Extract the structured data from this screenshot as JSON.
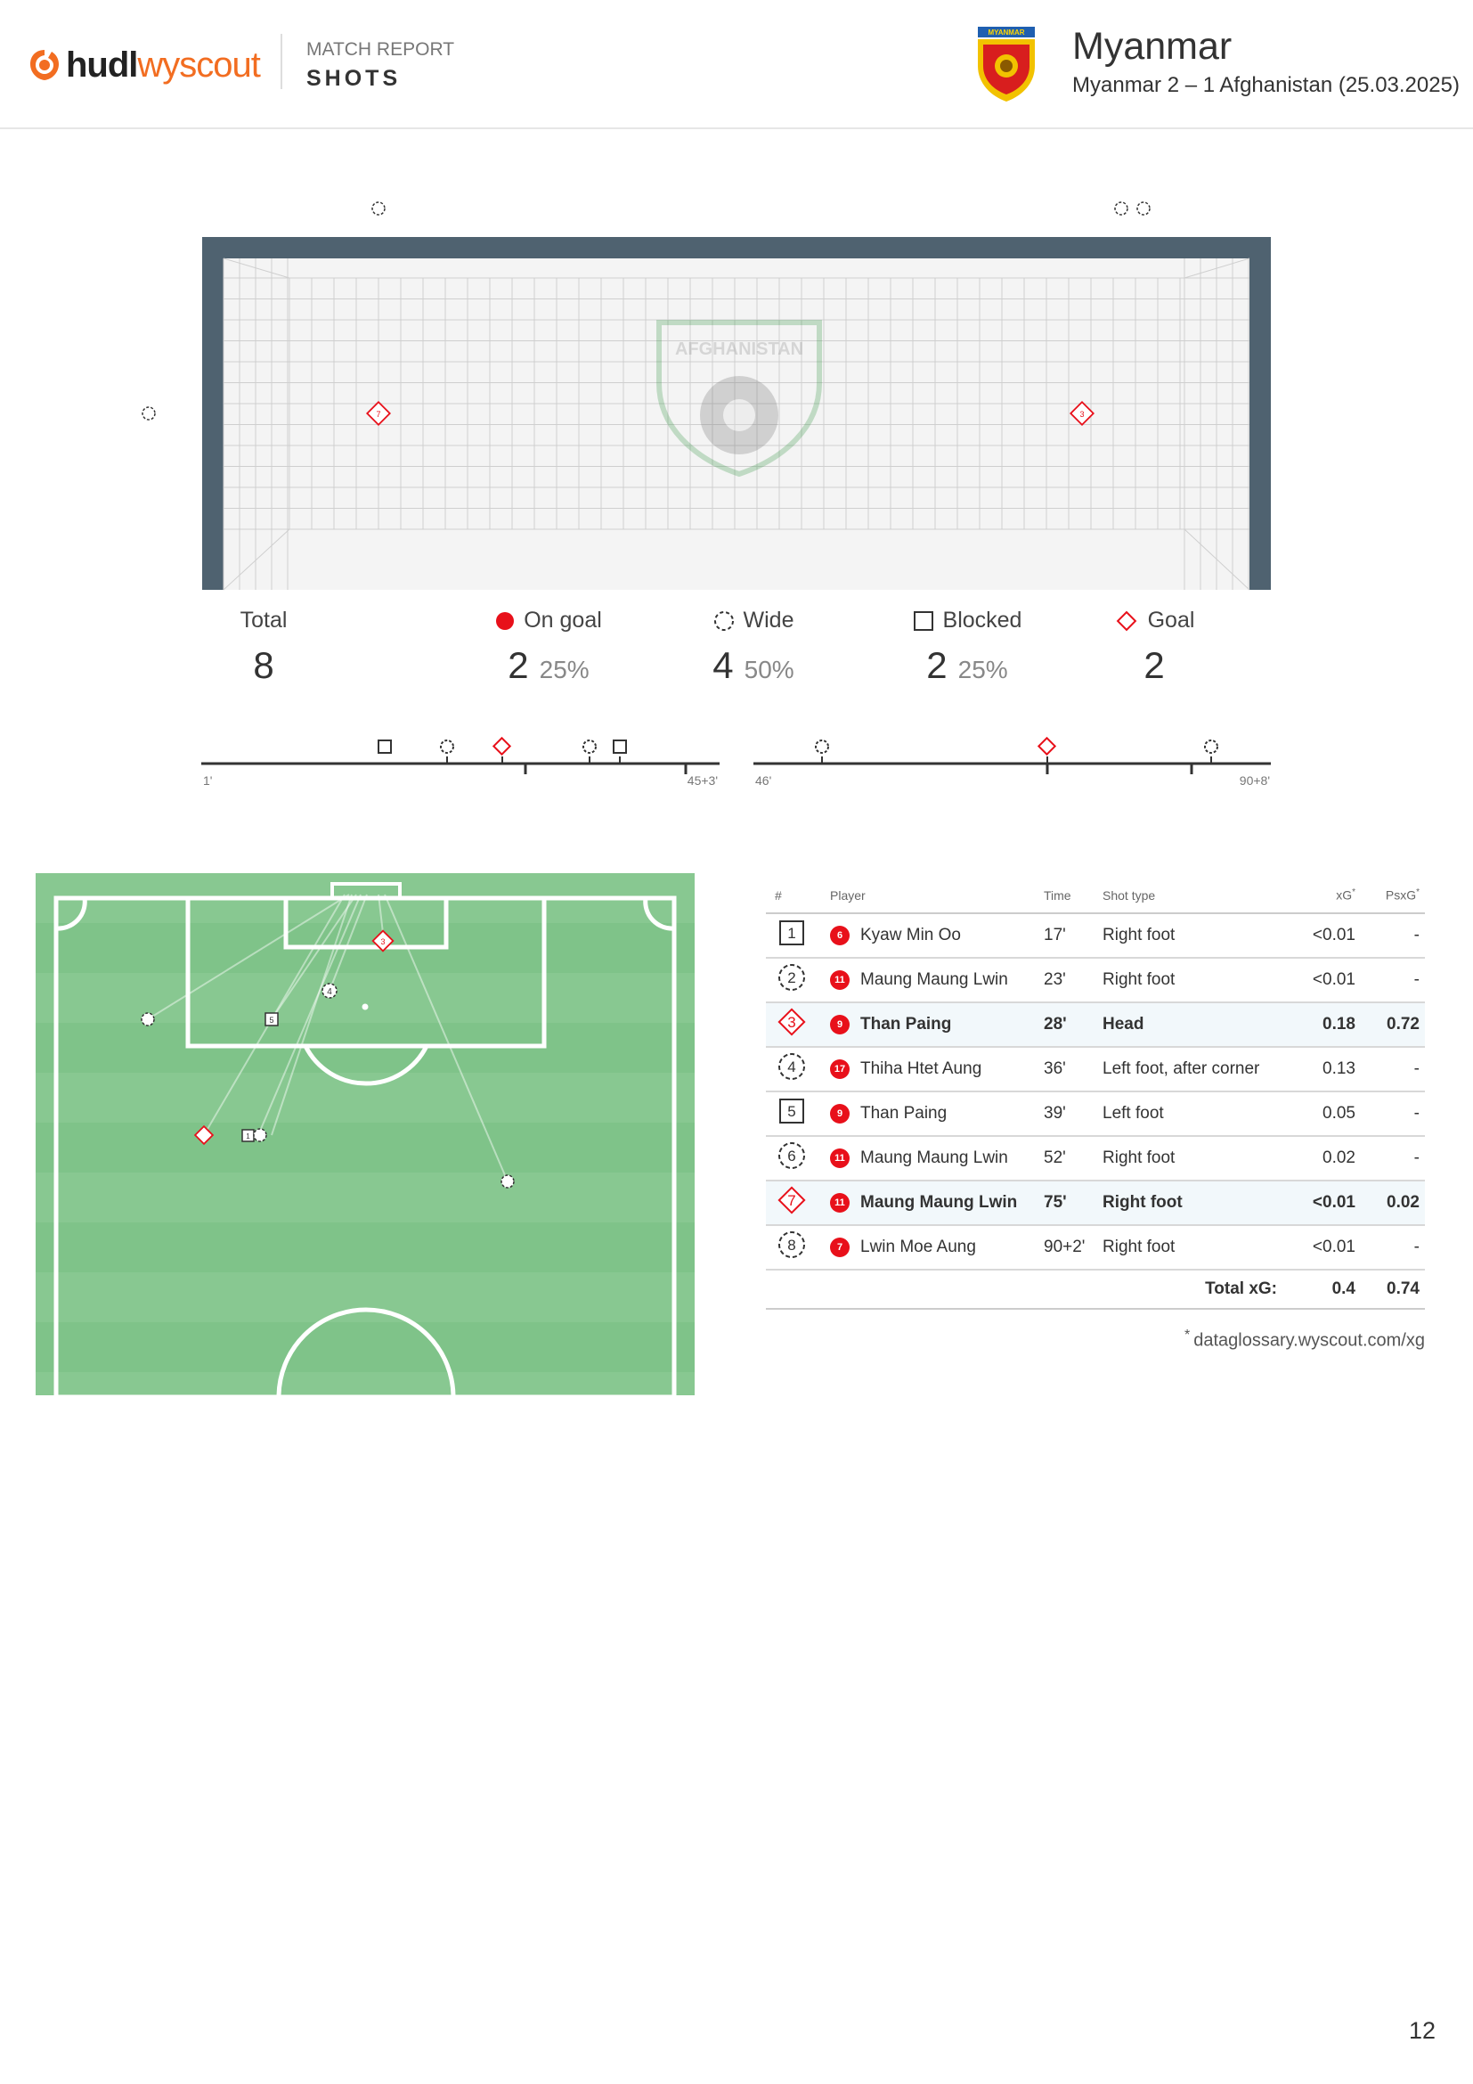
{
  "header": {
    "brand_left": "hudl",
    "brand_right": "wyscout",
    "report_label": "MATCH REPORT",
    "report_title": "SHOTS",
    "crest_label": "MYANMAR",
    "team_name": "Myanmar",
    "match_line": "Myanmar 2 – 1 Afghanistan (25.03.2025)"
  },
  "goal_watermark": "AFGHANISTAN",
  "summary": {
    "total": {
      "label": "Total",
      "value": "8"
    },
    "on_goal": {
      "label": "On goal",
      "value": "2",
      "pct": "25%"
    },
    "wide": {
      "label": "Wide",
      "value": "4",
      "pct": "50%"
    },
    "blocked": {
      "label": "Blocked",
      "value": "2",
      "pct": "25%"
    },
    "goal": {
      "label": "Goal",
      "value": "2"
    }
  },
  "timeline": {
    "first_half": {
      "start": "1'",
      "end": "45+3'"
    },
    "second_half": {
      "start": "46'",
      "end": "90+8'"
    }
  },
  "colors": {
    "goal": "#e8101a",
    "pitch": "#7fc389",
    "pitch_stripe": "#88c891",
    "frame": "#4f6270",
    "net_line": "#cfcfcf"
  },
  "table": {
    "headers": {
      "id": "#",
      "player": "Player",
      "time": "Time",
      "shot_type": "Shot type",
      "xg": "xG",
      "psxg": "PsxG",
      "asterisk": "*"
    },
    "rows": [
      {
        "id": "1",
        "outcome": "blocked",
        "jersey": "6",
        "player": "Kyaw Min Oo",
        "time": "17'",
        "shot_type": "Right foot",
        "xg": "<0.01",
        "psxg": "-"
      },
      {
        "id": "2",
        "outcome": "wide",
        "jersey": "11",
        "player": "Maung Maung Lwin",
        "time": "23'",
        "shot_type": "Right foot",
        "xg": "<0.01",
        "psxg": "-"
      },
      {
        "id": "3",
        "outcome": "goal",
        "jersey": "9",
        "player": "Than Paing",
        "time": "28'",
        "shot_type": "Head",
        "xg": "0.18",
        "psxg": "0.72"
      },
      {
        "id": "4",
        "outcome": "wide",
        "jersey": "17",
        "player": "Thiha Htet Aung",
        "time": "36'",
        "shot_type": "Left foot, after corner",
        "xg": "0.13",
        "psxg": "-"
      },
      {
        "id": "5",
        "outcome": "blocked",
        "jersey": "9",
        "player": "Than Paing",
        "time": "39'",
        "shot_type": "Left foot",
        "xg": "0.05",
        "psxg": "-"
      },
      {
        "id": "6",
        "outcome": "wide",
        "jersey": "11",
        "player": "Maung Maung Lwin",
        "time": "52'",
        "shot_type": "Right foot",
        "xg": "0.02",
        "psxg": "-"
      },
      {
        "id": "7",
        "outcome": "goal",
        "jersey": "11",
        "player": "Maung Maung Lwin",
        "time": "75'",
        "shot_type": "Right foot",
        "xg": "<0.01",
        "psxg": "0.02"
      },
      {
        "id": "8",
        "outcome": "wide",
        "jersey": "7",
        "player": "Lwin Moe Aung",
        "time": "90+2'",
        "shot_type": "Right foot",
        "xg": "<0.01",
        "psxg": "-"
      }
    ],
    "total_label": "Total xG:",
    "total_xg": "0.4",
    "total_psxg": "0.74"
  },
  "footnote": {
    "star": "*",
    "text": "dataglossary.wyscout.com/xg"
  },
  "page_number": "12"
}
